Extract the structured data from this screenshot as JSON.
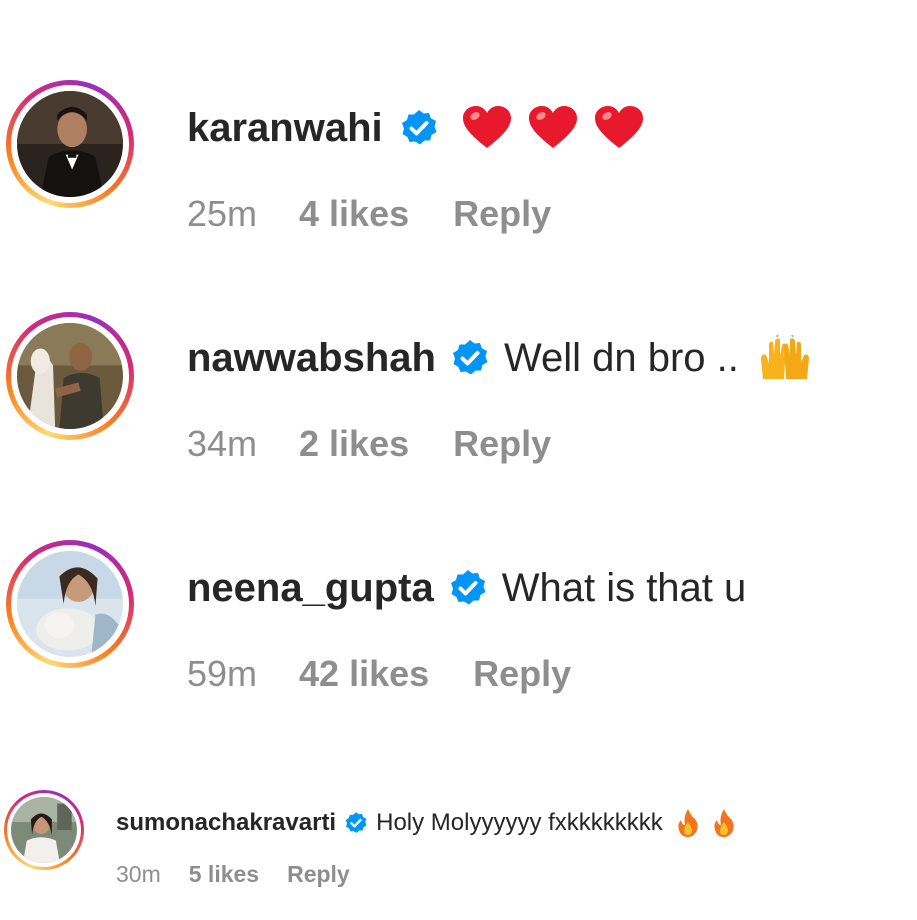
{
  "comments": [
    {
      "username": "karanwahi",
      "verified": true,
      "text": "",
      "emojis": [
        "red-heart",
        "red-heart",
        "red-heart"
      ],
      "time": "25m",
      "likes": "4 likes",
      "reply": "Reply"
    },
    {
      "username": "nawwabshah",
      "verified": true,
      "text": "Well dn bro ..",
      "emojis": [
        "raising-hands"
      ],
      "time": "34m",
      "likes": "2 likes",
      "reply": "Reply"
    },
    {
      "username": "neena_gupta",
      "verified": true,
      "text": "What is that u",
      "emojis": [],
      "time": "59m",
      "likes": "42 likes",
      "reply": "Reply"
    },
    {
      "username": "sumonachakravarti",
      "verified": true,
      "text": "Holy Molyyyyyy fxkkkkkkkk",
      "emojis": [
        "fire",
        "fire"
      ],
      "time": "30m",
      "likes": "5 likes",
      "reply": "Reply"
    }
  ],
  "colors": {
    "verified_blue": "#0095f6",
    "meta_gray": "#8e8e8e",
    "text": "#262626"
  }
}
